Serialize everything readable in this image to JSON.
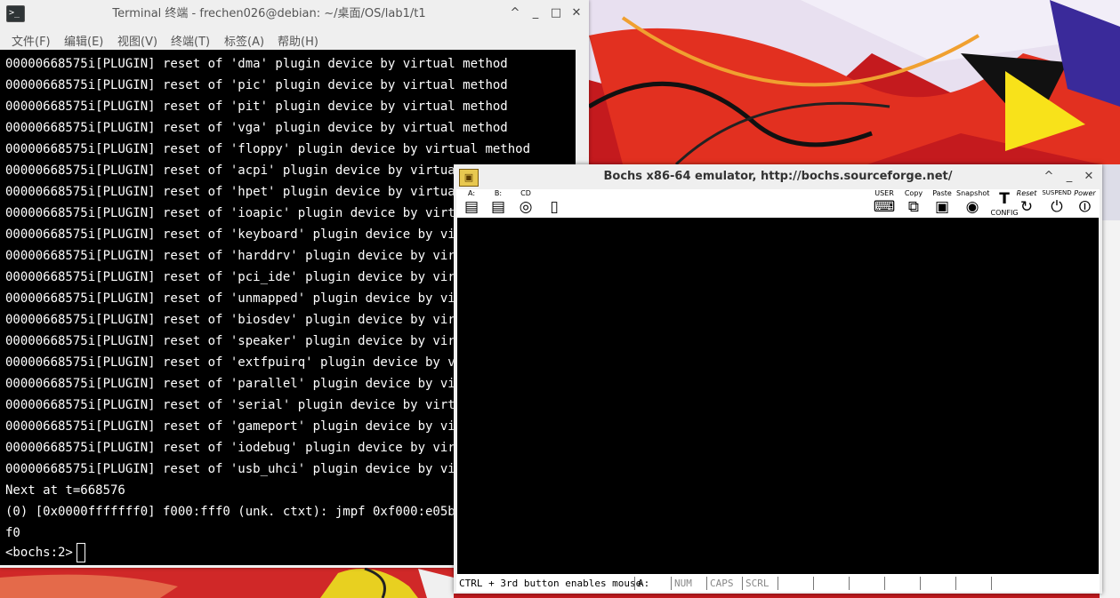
{
  "terminal": {
    "title": "Terminal 终端 - frechen026@debian: ~/桌面/OS/lab1/t1",
    "icon": "terminal-icon",
    "window_buttons": {
      "collapse": "^",
      "minimize": "_",
      "maximize": "□",
      "close": "✕"
    },
    "menu": [
      "文件(F)",
      "编辑(E)",
      "视图(V)",
      "终端(T)",
      "标签(A)",
      "帮助(H)"
    ],
    "lines": [
      "00000668575i[PLUGIN] reset of 'dma' plugin device by virtual method",
      "00000668575i[PLUGIN] reset of 'pic' plugin device by virtual method",
      "00000668575i[PLUGIN] reset of 'pit' plugin device by virtual method",
      "00000668575i[PLUGIN] reset of 'vga' plugin device by virtual method",
      "00000668575i[PLUGIN] reset of 'floppy' plugin device by virtual method",
      "00000668575i[PLUGIN] reset of 'acpi' plugin device by virtual m",
      "00000668575i[PLUGIN] reset of 'hpet' plugin device by virtual m",
      "00000668575i[PLUGIN] reset of 'ioapic' plugin device by virtual",
      "00000668575i[PLUGIN] reset of 'keyboard' plugin device by virtu",
      "00000668575i[PLUGIN] reset of 'harddrv' plugin device by virtua",
      "00000668575i[PLUGIN] reset of 'pci_ide' plugin device by virtua",
      "00000668575i[PLUGIN] reset of 'unmapped' plugin device by virtu",
      "00000668575i[PLUGIN] reset of 'biosdev' plugin device by virtua",
      "00000668575i[PLUGIN] reset of 'speaker' plugin device by virtua",
      "00000668575i[PLUGIN] reset of 'extfpuirq' plugin device by virt",
      "00000668575i[PLUGIN] reset of 'parallel' plugin device by virtu",
      "00000668575i[PLUGIN] reset of 'serial' plugin device by virtual",
      "00000668575i[PLUGIN] reset of 'gameport' plugin device by virtu",
      "00000668575i[PLUGIN] reset of 'iodebug' plugin device by virtua",
      "00000668575i[PLUGIN] reset of 'usb_uhci' plugin device by virtu",
      "Next at t=668576",
      "(0) [0x0000fffffff0] f000:fff0 (unk. ctxt): jmpf 0xf000:e05b",
      "f0"
    ],
    "prompt": "<bochs:2>"
  },
  "bochs": {
    "title": "Bochs x86-64 emulator, http://bochs.sourceforge.net/",
    "icon": "bochs-box-icon",
    "window_buttons": {
      "collapse": "^",
      "minimize": "_",
      "close": "✕"
    },
    "toolbar_left": [
      {
        "label": "A:",
        "icon": "floppy-a-icon",
        "glyph": "▤"
      },
      {
        "label": "B:",
        "icon": "floppy-b-icon",
        "glyph": "▤"
      },
      {
        "label": "CD",
        "icon": "cdrom-icon",
        "glyph": "◎"
      },
      {
        "label": "",
        "icon": "usb-icon",
        "glyph": "▯"
      }
    ],
    "toolbar_right": [
      {
        "label": "USER",
        "icon": "keyboard-icon",
        "glyph": "⌨"
      },
      {
        "label": "Copy",
        "icon": "copy-icon",
        "glyph": "⧉"
      },
      {
        "label": "Paste",
        "icon": "paste-icon",
        "glyph": "▣"
      },
      {
        "label": "Snapshot",
        "icon": "camera-icon",
        "glyph": "◉"
      },
      {
        "label": "CONFIG",
        "icon": "config-icon",
        "glyph": "T"
      },
      {
        "label": "Reset",
        "icon": "reset-icon",
        "glyph": "↻"
      },
      {
        "label": "SUSPEND",
        "icon": "suspend-icon",
        "glyph": "⏻"
      },
      {
        "label": "Power",
        "icon": "power-icon",
        "glyph": "⏼"
      }
    ],
    "status": {
      "mouse_hint": "CTRL + 3rd button enables mouse",
      "drive": "A:",
      "num": "NUM",
      "caps": "CAPS",
      "scrl": "SCRL"
    }
  },
  "colors": {
    "terminal_bg": "#000000",
    "terminal_fg": "#ffffff",
    "chrome": "#efefef",
    "wallpaper_accent": "#c81818"
  }
}
